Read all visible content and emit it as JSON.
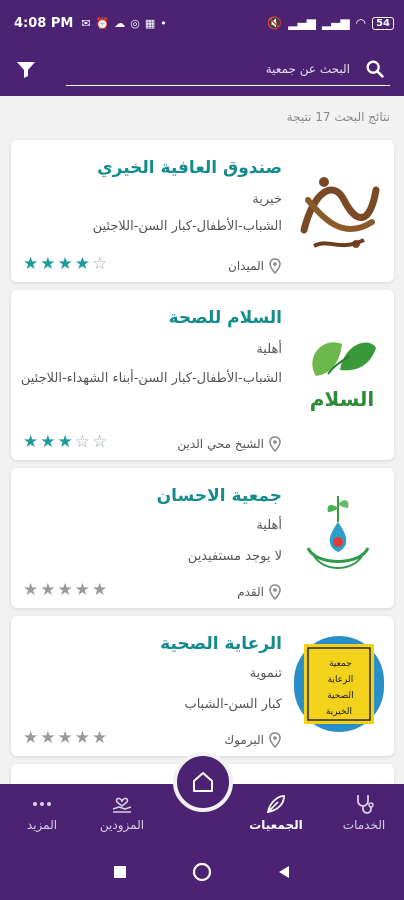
{
  "status_bar": {
    "time": "4:08 PM",
    "battery": "54"
  },
  "search": {
    "placeholder": "البحث عن جمعية"
  },
  "results": {
    "count_text": "نتائج البحث 17 نتيجة"
  },
  "colors": {
    "primary": "#4b2372",
    "title": "#158b8b",
    "star_on": "#1e9c9c",
    "star_off": "#9a9a9a"
  },
  "cards": [
    {
      "title": "صندوق العافية الخيري",
      "type": "خيرية",
      "beneficiaries": "الشباب-الأطفال-كبار السن-اللاجئين",
      "location": "الميدان",
      "rating": 4,
      "max_rating": 5,
      "logo_icon": "al-afia-calligraphy-logo"
    },
    {
      "title": "السلام للصحة",
      "type": "أهلية",
      "beneficiaries": "الشباب-الأطفال-كبار السن-أبناء الشهداء-اللاجئين",
      "location": "الشيخ محي الدين",
      "rating": 3,
      "max_rating": 5,
      "logo_icon": "salam-leaf-logo",
      "logo_text": "السلام"
    },
    {
      "title": "جمعية الاحسان",
      "type": "أهلية",
      "beneficiaries": "لا يوجد مستفيدين",
      "location": "القدم",
      "rating": 0,
      "max_rating": 5,
      "logo_icon": "ihsan-hands-drop-logo"
    },
    {
      "title": "الرعاية الصحية",
      "type": "تنموية",
      "beneficiaries": "كبار السن-الشباب",
      "location": "اليرموك",
      "rating": 0,
      "max_rating": 5,
      "logo_icon": "health-care-yellow-logo",
      "logo_text": "جمعية الرعاية الصحية الخيرية"
    }
  ],
  "bottom_nav": [
    {
      "label": "الخدمات",
      "icon": "stethoscope-icon"
    },
    {
      "label": "الجمعيات",
      "icon": "leaf-icon",
      "active": true
    },
    {
      "label": "المزودين",
      "icon": "hand-heart-icon"
    },
    {
      "label": "المزيد",
      "icon": "more-dots-icon"
    }
  ]
}
